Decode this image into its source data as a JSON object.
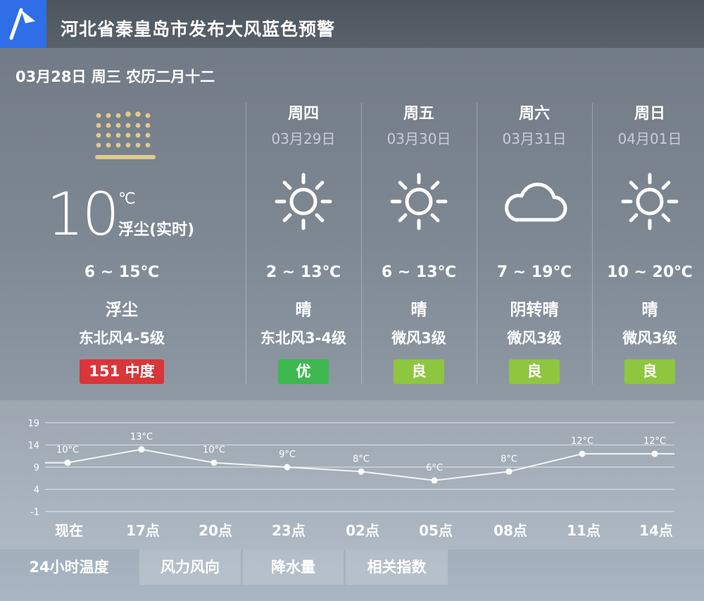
{
  "alert": {
    "title": "河北省秦皇岛市发布大风蓝色预警"
  },
  "today": {
    "date_line": "03月28日  周三  农历二月十二",
    "temp": "10",
    "unit": "℃",
    "desc": "浮尘(实时)",
    "range": "6 ~ 15℃",
    "weather": "浮尘",
    "wind": "东北风4-5级",
    "aqi": "151 中度",
    "aqi_color": "#d9363a",
    "icon": "dust-icon"
  },
  "forecast": [
    {
      "day": "周四",
      "date": "03月29日",
      "icon": "sunny-icon",
      "range": "2 ~ 13℃",
      "weather": "晴",
      "wind": "东北风3-4级",
      "aqi": "优",
      "aqi_color": "#3db84f"
    },
    {
      "day": "周五",
      "date": "03月30日",
      "icon": "sunny-icon",
      "range": "6 ~ 13℃",
      "weather": "晴",
      "wind": "微风3级",
      "aqi": "良",
      "aqi_color": "#8ec63f"
    },
    {
      "day": "周六",
      "date": "03月31日",
      "icon": "cloudy-icon",
      "range": "7 ~ 19℃",
      "weather": "阴转晴",
      "wind": "微风3级",
      "aqi": "良",
      "aqi_color": "#8ec63f"
    },
    {
      "day": "周日",
      "date": "04月01日",
      "icon": "sunny-icon",
      "range": "10 ~ 20℃",
      "weather": "晴",
      "wind": "微风3级",
      "aqi": "良",
      "aqi_color": "#8ec63f"
    }
  ],
  "chart_data": {
    "type": "line",
    "categories": [
      "现在",
      "17点",
      "20点",
      "23点",
      "02点",
      "05点",
      "08点",
      "11点",
      "14点"
    ],
    "values": [
      10,
      13,
      10,
      9,
      8,
      6,
      8,
      12,
      12
    ],
    "point_labels": [
      "10°C",
      "13°C",
      "10°C",
      "9°C",
      "8°C",
      "6°C",
      "8°C",
      "12°C",
      "12°C"
    ],
    "y_ticks": [
      19,
      14,
      9,
      4,
      -1
    ],
    "ylim": [
      -1,
      19
    ],
    "grid": true
  },
  "tabs": [
    {
      "label": "24小时温度",
      "active": true
    },
    {
      "label": "风力风向",
      "active": false
    },
    {
      "label": "降水量",
      "active": false
    },
    {
      "label": "相关指数",
      "active": false
    }
  ]
}
